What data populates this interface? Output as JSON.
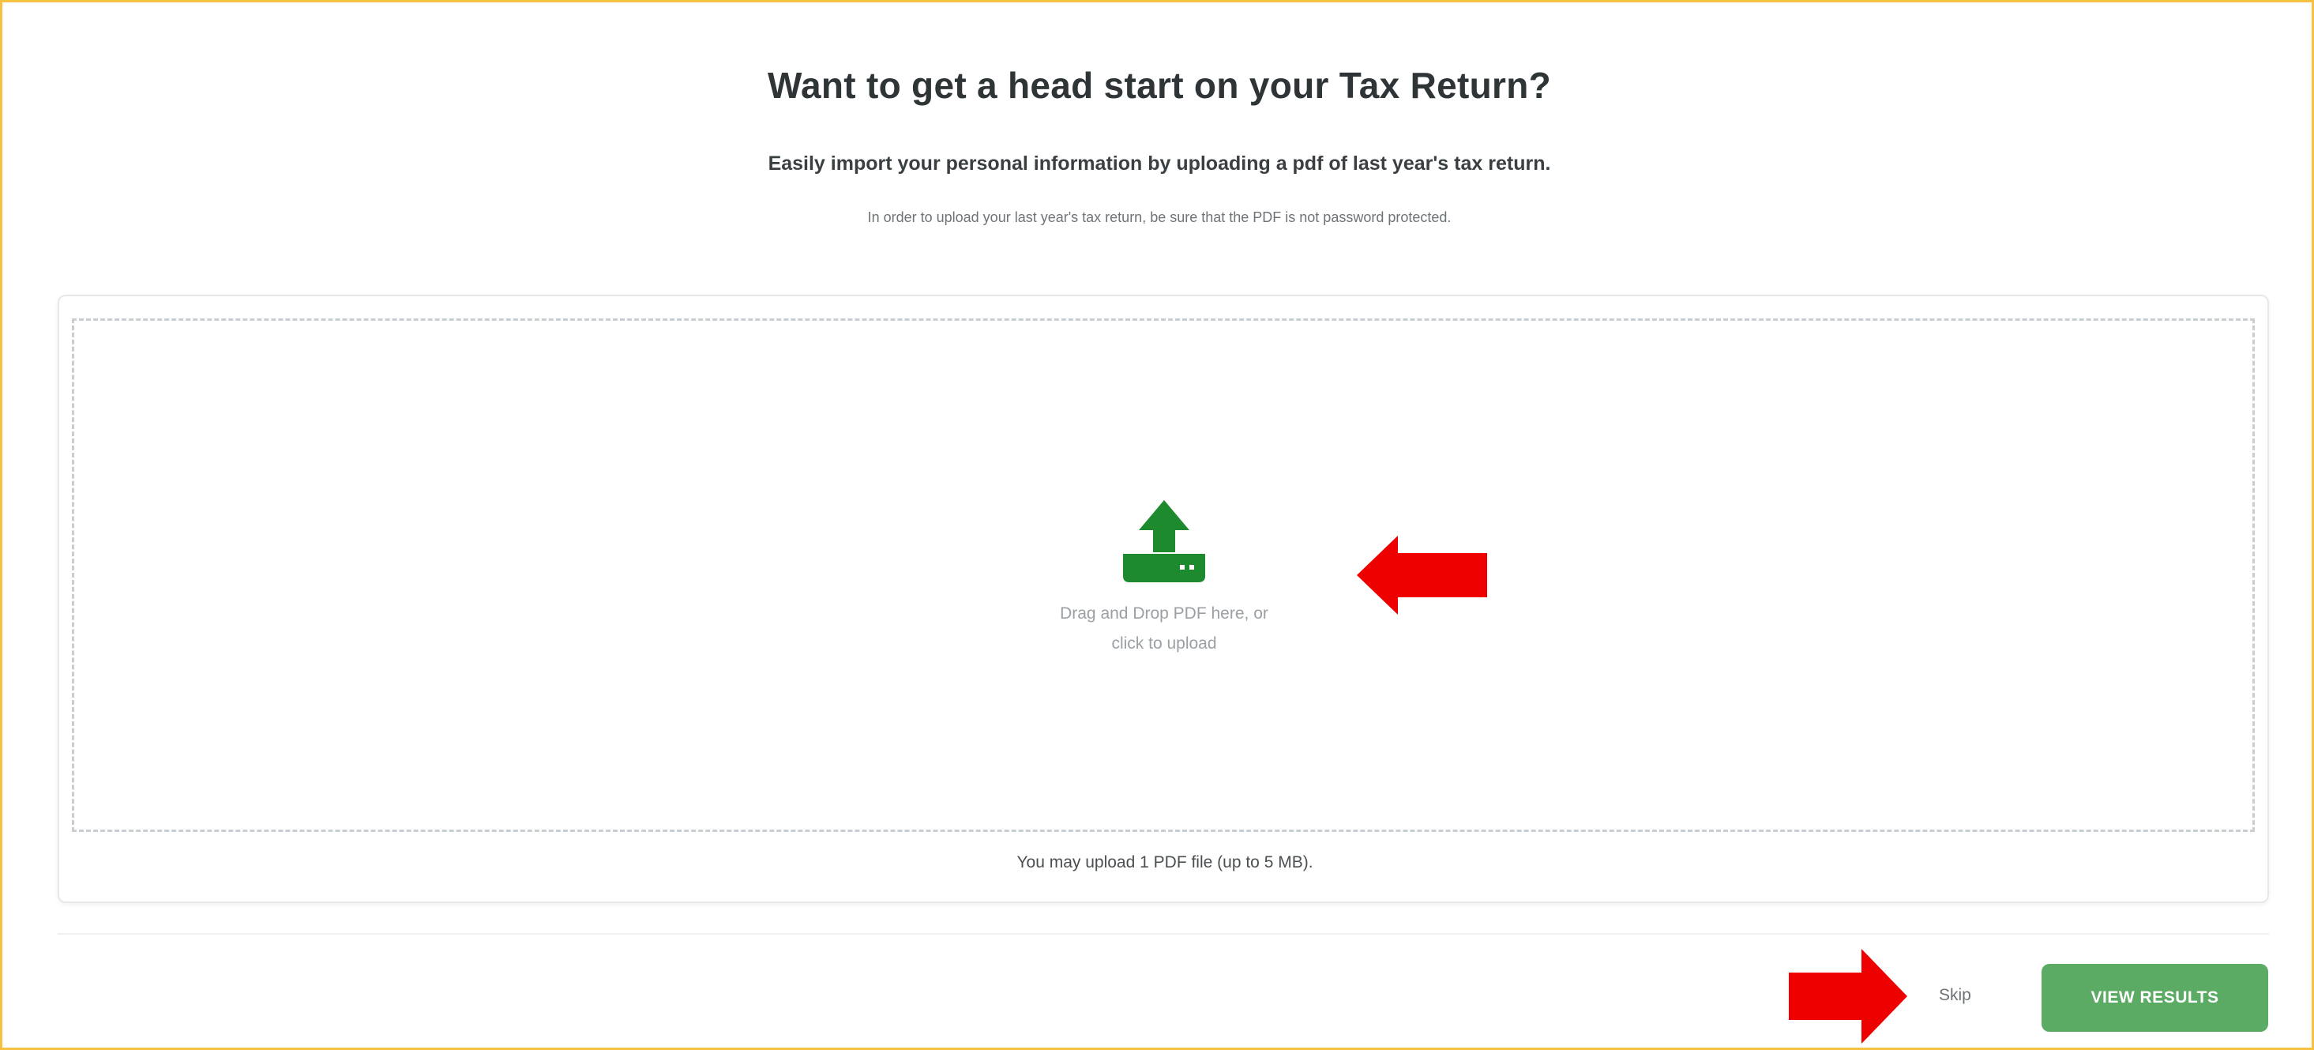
{
  "header": {
    "title": "Want to get a head start on your Tax Return?",
    "subtitle": "Easily import your personal information by uploading a pdf of last year's tax return.",
    "note": "In order to upload your last year's tax return, be sure that the PDF is not password protected."
  },
  "upload": {
    "icon": "upload-tray-icon",
    "prompt_line1": "Drag and Drop PDF here, or",
    "prompt_line2": "click to upload",
    "limit_note": "You may upload 1 PDF file (up to 5 MB)."
  },
  "footer": {
    "skip_label": "Skip",
    "view_results_label": "VIEW RESULTS"
  },
  "colors": {
    "frame_border": "#f6c141",
    "accent_green": "#5bab65",
    "icon_green": "#1e8a2e",
    "annotation_red": "#ee0000"
  }
}
